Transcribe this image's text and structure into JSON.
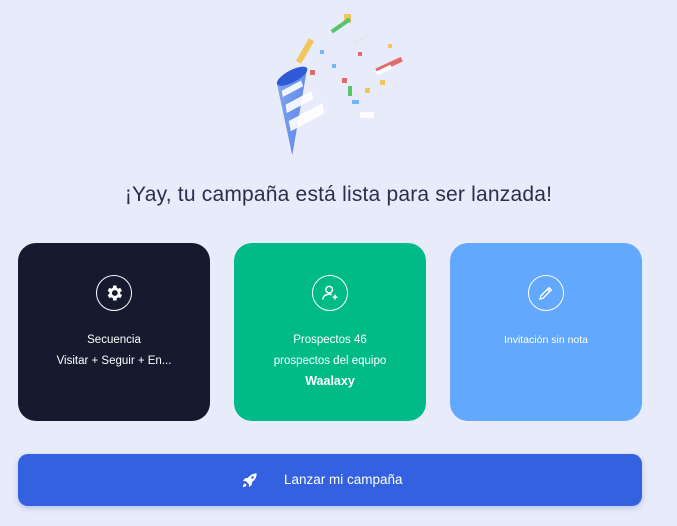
{
  "title": "¡Yay, tu campaña está lista para ser lanzada!",
  "cards": {
    "sequence": {
      "line1": "Secuencia",
      "line2": "Visitar + Seguir + En...",
      "icon": "gear-icon",
      "color": "#151a2e"
    },
    "prospects": {
      "line1": "Prospectos 46",
      "line2": "prospectos del equipo",
      "line3": "Waalaxy",
      "icon": "user-plus-icon",
      "color": "#00bb87"
    },
    "invitation": {
      "line1": "Invitación sin nota",
      "icon": "pencil-icon",
      "color": "#62a8fe"
    }
  },
  "launch_button": {
    "label": "Lanzar mi campaña",
    "icon": "rocket-icon",
    "color": "#3461df"
  }
}
